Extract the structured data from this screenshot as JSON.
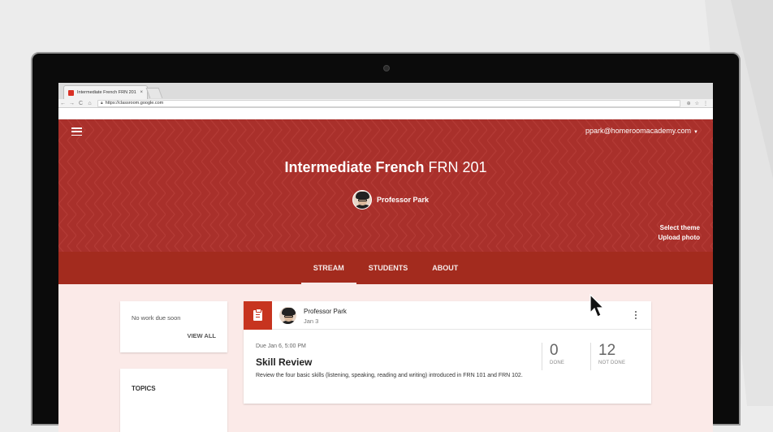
{
  "browser": {
    "tab_title": "Intermediate French FRN 201",
    "tab_close": "×",
    "url": "https://classroom.google.com",
    "nav_back": "←",
    "nav_forward": "→",
    "nav_reload": "C",
    "nav_home": "⌂",
    "right_icons": [
      "⊕",
      "☆",
      "⋮"
    ]
  },
  "header": {
    "account": "ppark@homeroomacademy.com",
    "class_name": "Intermediate French",
    "class_section": "FRN 201",
    "teacher": "Professor Park",
    "select_theme": "Select theme",
    "upload_photo": "Upload photo"
  },
  "tabs": [
    {
      "label": "STREAM",
      "active": true
    },
    {
      "label": "STUDENTS",
      "active": false
    },
    {
      "label": "ABOUT",
      "active": false
    }
  ],
  "sidebar": {
    "upcoming_text": "No work due soon",
    "view_all": "VIEW ALL",
    "topics_title": "TOPICS"
  },
  "post": {
    "author": "Professor Park",
    "date": "Jan 3",
    "due": "Due Jan 6, 5:00 PM",
    "title": "Skill Review",
    "description": "Review the four basic skills (listening, speaking, reading and writing) introduced in FRN 101 and FRN 102.",
    "done_count": "0",
    "done_label": "DONE",
    "not_done_count": "12",
    "not_done_label": "NOT DONE"
  },
  "colors": {
    "banner": "#a9302b",
    "tab_strip": "#a32b1e",
    "assignment_icon": "#c7341f",
    "content_bg": "#fbeae8"
  }
}
